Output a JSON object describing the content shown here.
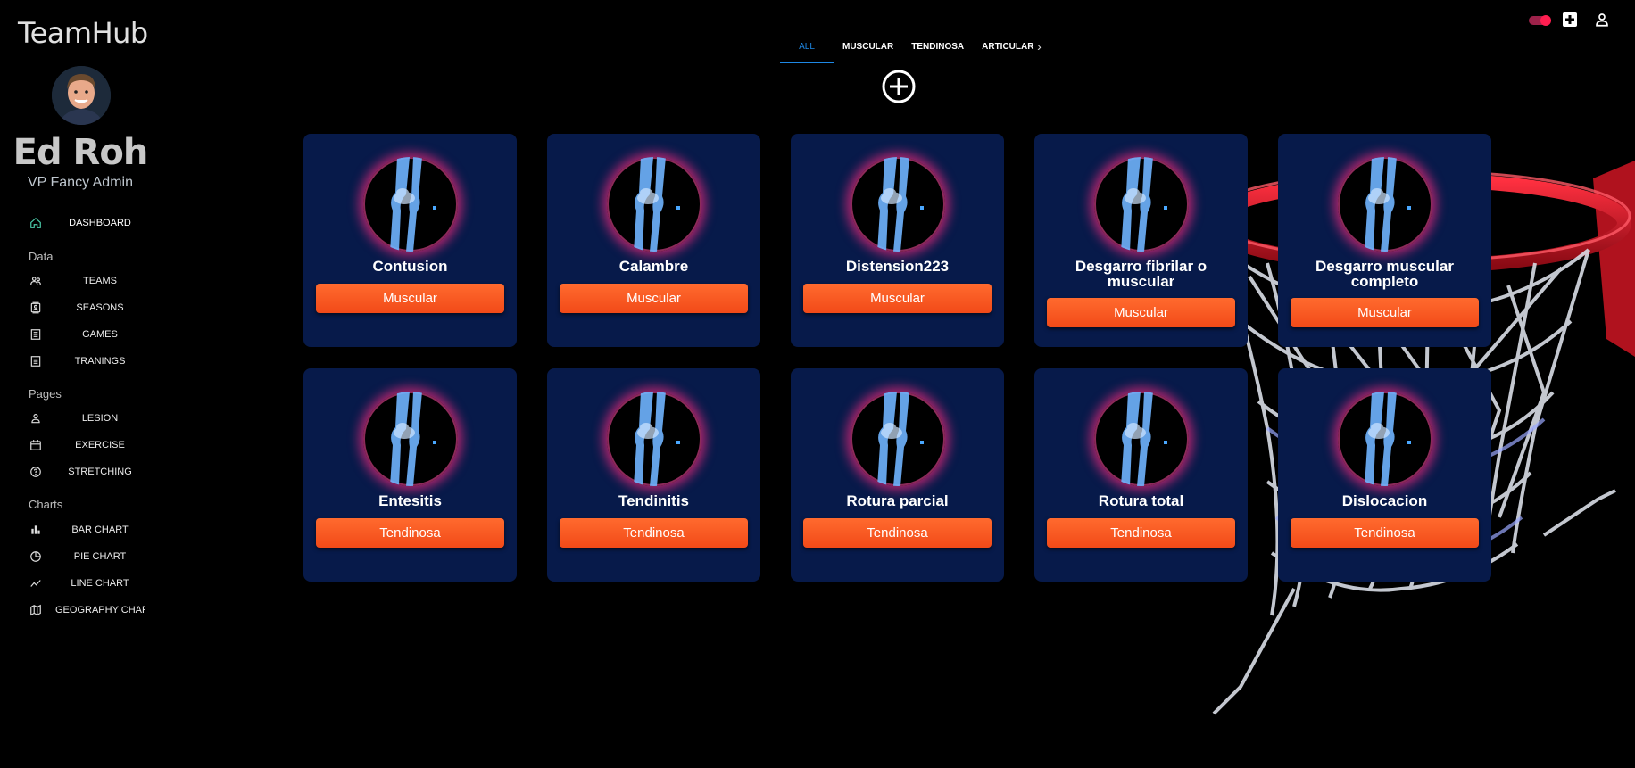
{
  "app": {
    "title": "TeamHub"
  },
  "user": {
    "name": "Ed Roh",
    "role": "VP Fancy Admin"
  },
  "sidebar": {
    "dashboard": {
      "label": "DASHBOARD",
      "icon": "home-icon"
    },
    "sections": [
      {
        "label": "Data",
        "items": [
          {
            "label": "TEAMS",
            "icon": "people-icon"
          },
          {
            "label": "SEASONS",
            "icon": "contacts-icon"
          },
          {
            "label": "GAMES",
            "icon": "receipt-icon"
          },
          {
            "label": "TRANINGS",
            "icon": "receipt-icon"
          }
        ]
      },
      {
        "label": "Pages",
        "items": [
          {
            "label": "LESION",
            "icon": "person-icon"
          },
          {
            "label": "EXERCISE",
            "icon": "calendar-icon"
          },
          {
            "label": "STRETCHING",
            "icon": "help-icon"
          }
        ]
      },
      {
        "label": "Charts",
        "items": [
          {
            "label": "BAR CHART",
            "icon": "bar-chart-icon"
          },
          {
            "label": "PIE CHART",
            "icon": "pie-chart-icon"
          },
          {
            "label": "LINE CHART",
            "icon": "line-chart-icon"
          },
          {
            "label": "GEOGRAPHY CHART",
            "icon": "map-icon"
          }
        ]
      }
    ]
  },
  "tabs": [
    {
      "label": "ALL",
      "active": true
    },
    {
      "label": "MUSCULAR"
    },
    {
      "label": "TENDINOSA"
    },
    {
      "label": "ARTICULAR"
    }
  ],
  "colors": {
    "accent": "#1e88e5",
    "card_bg": "#071a4a",
    "button": "#f4511e",
    "glow": "#e12878"
  },
  "cards": [
    {
      "title": "Contusion",
      "category": "Muscular"
    },
    {
      "title": "Calambre",
      "category": "Muscular"
    },
    {
      "title": "Distension223",
      "category": "Muscular"
    },
    {
      "title": "Desgarro fibrilar o muscular",
      "category": "Muscular"
    },
    {
      "title": "Desgarro muscular completo",
      "category": "Muscular"
    },
    {
      "title": "Entesitis",
      "category": "Tendinosa"
    },
    {
      "title": "Tendinitis",
      "category": "Tendinosa"
    },
    {
      "title": "Rotura parcial",
      "category": "Tendinosa"
    },
    {
      "title": "Rotura total",
      "category": "Tendinosa"
    },
    {
      "title": "Dislocacion",
      "category": "Tendinosa"
    }
  ]
}
